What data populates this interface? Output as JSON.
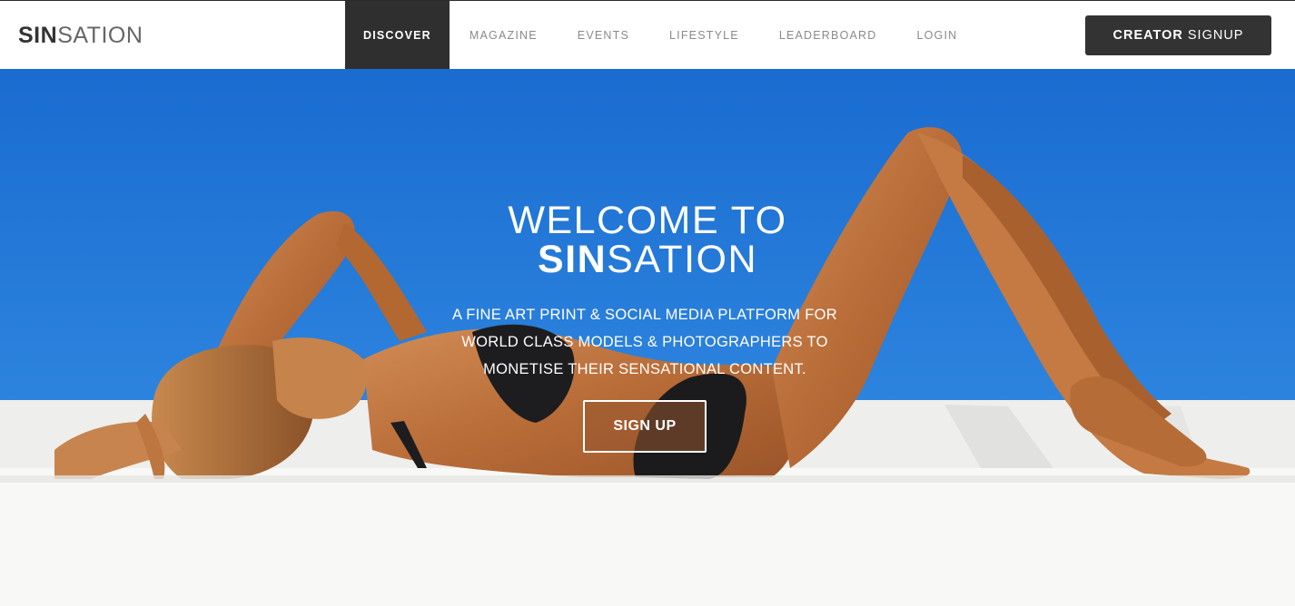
{
  "header": {
    "logo": {
      "bold": "SIN",
      "light": "SATION"
    },
    "nav": [
      {
        "label": "DISCOVER",
        "active": true
      },
      {
        "label": "MAGAZINE",
        "active": false
      },
      {
        "label": "EVENTS",
        "active": false
      },
      {
        "label": "LIFESTYLE",
        "active": false
      },
      {
        "label": "LEADERBOARD",
        "active": false
      },
      {
        "label": "LOGIN",
        "active": false
      }
    ],
    "creator_button": {
      "bold": "CREATOR",
      "light": "SIGNUP"
    }
  },
  "hero": {
    "title_line1": "WELCOME TO",
    "title_bold": "SIN",
    "title_light": "SATION",
    "subtitle_line1": "A FINE ART PRINT & SOCIAL MEDIA PLATFORM FOR",
    "subtitle_line2": "WORLD CLASS MODELS & PHOTOGRAPHERS TO",
    "subtitle_line3": "MONETISE THEIR SENSATIONAL CONTENT.",
    "signup_label": "SIGN UP",
    "image_description": "hero-photo"
  },
  "colors": {
    "header_bg": "#ffffff",
    "nav_active_bg": "#2f2f2f",
    "nav_text": "#8a8a8a",
    "button_dark": "#333333",
    "sky_top": "#1b6fd0",
    "sky_bottom": "#2a7fdc",
    "wall": "#f4f4f2",
    "skin": "#c27a45"
  }
}
